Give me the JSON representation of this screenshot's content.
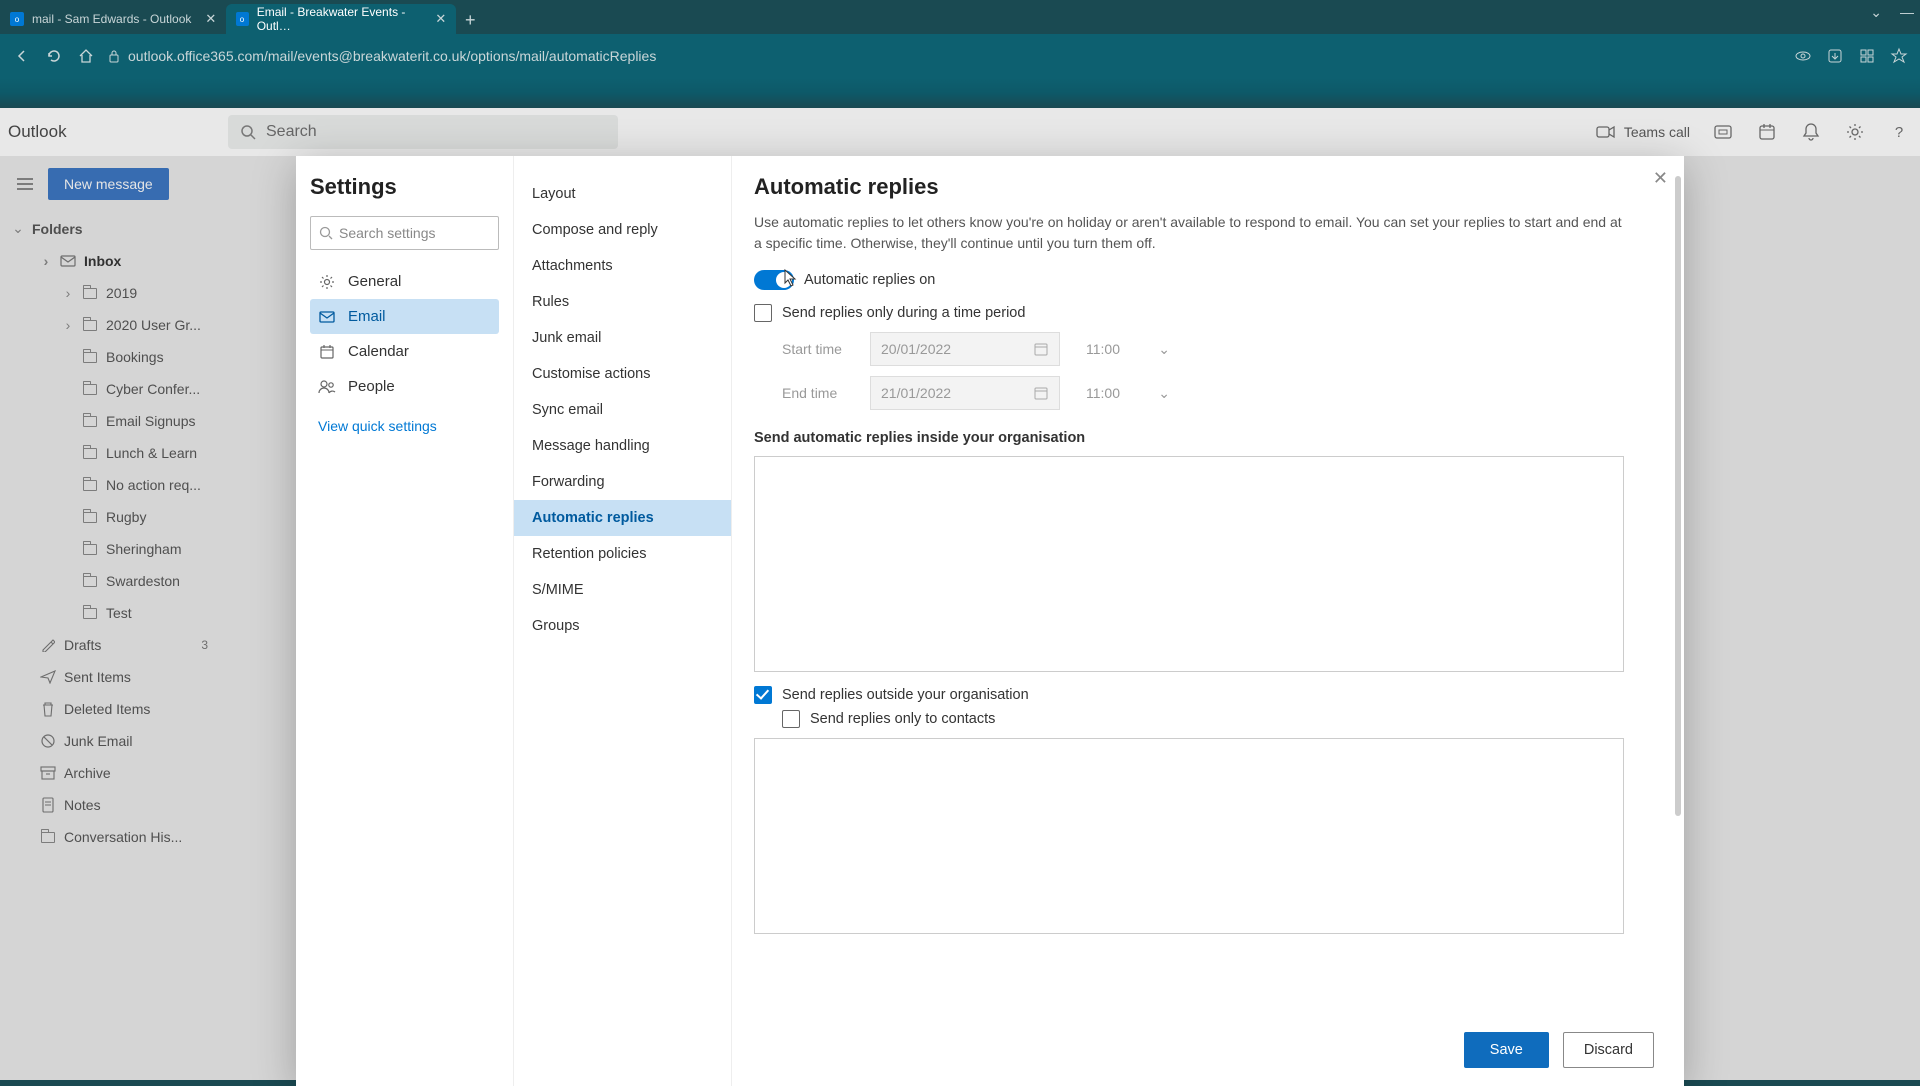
{
  "browser": {
    "tabs": [
      {
        "title": "mail - Sam Edwards - Outlook",
        "active": false
      },
      {
        "title": "Email - Breakwater Events - Outl…",
        "active": true
      }
    ],
    "url": "outlook.office365.com/mail/events@breakwaterit.co.uk/options/mail/automaticReplies"
  },
  "owa": {
    "brand": "Outlook",
    "search_placeholder": "Search",
    "teams_call": "Teams call",
    "new_message": "New message",
    "folders_label": "Folders",
    "folders": [
      {
        "label": "Inbox",
        "bold": true,
        "level": "sub",
        "caret": true,
        "icon": "mail"
      },
      {
        "label": "2019",
        "level": "subsub",
        "caret": true,
        "icon": "folder"
      },
      {
        "label": "2020 User Gr...",
        "level": "subsub",
        "caret": true,
        "icon": "folder"
      },
      {
        "label": "Bookings",
        "level": "subsub",
        "icon": "folder"
      },
      {
        "label": "Cyber Confer...",
        "level": "subsub",
        "icon": "folder"
      },
      {
        "label": "Email Signups",
        "level": "subsub",
        "icon": "folder"
      },
      {
        "label": "Lunch & Learn",
        "level": "subsub",
        "icon": "folder"
      },
      {
        "label": "No action req...",
        "level": "subsub",
        "icon": "folder"
      },
      {
        "label": "Rugby",
        "level": "subsub",
        "icon": "folder"
      },
      {
        "label": "Sheringham",
        "level": "subsub",
        "icon": "folder"
      },
      {
        "label": "Swardeston",
        "level": "subsub",
        "icon": "folder"
      },
      {
        "label": "Test",
        "level": "subsub",
        "icon": "folder"
      },
      {
        "label": "Drafts",
        "level": "sub",
        "icon": "draft",
        "count": "3"
      },
      {
        "label": "Sent Items",
        "level": "sub",
        "icon": "sent"
      },
      {
        "label": "Deleted Items",
        "level": "sub",
        "icon": "trash"
      },
      {
        "label": "Junk Email",
        "level": "sub",
        "icon": "junk"
      },
      {
        "label": "Archive",
        "level": "sub",
        "icon": "archive"
      },
      {
        "label": "Notes",
        "level": "sub",
        "icon": "note"
      },
      {
        "label": "Conversation His...",
        "level": "sub",
        "icon": "folder"
      }
    ]
  },
  "settings": {
    "title": "Settings",
    "search_placeholder": "Search settings",
    "quick_settings": "View quick settings",
    "categories": [
      {
        "label": "General",
        "icon": "gear"
      },
      {
        "label": "Email",
        "icon": "mail",
        "active": true
      },
      {
        "label": "Calendar",
        "icon": "calendar"
      },
      {
        "label": "People",
        "icon": "people"
      }
    ],
    "subitems": [
      "Layout",
      "Compose and reply",
      "Attachments",
      "Rules",
      "Junk email",
      "Customise actions",
      "Sync email",
      "Message handling",
      "Forwarding",
      "Automatic replies",
      "Retention policies",
      "S/MIME",
      "Groups"
    ],
    "sub_active": "Automatic replies"
  },
  "auto": {
    "title": "Automatic replies",
    "desc": "Use automatic replies to let others know you're on holiday or aren't available to respond to email. You can set your replies to start and end at a specific time. Otherwise, they'll continue until you turn them off.",
    "toggle_label": "Automatic replies on",
    "time_period_label": "Send replies only during a time period",
    "start_label": "Start time",
    "end_label": "End time",
    "start_date": "20/01/2022",
    "start_time": "11:00",
    "end_date": "21/01/2022",
    "end_time": "11:00",
    "inside_label": "Send automatic replies inside your organisation",
    "outside_label": "Send replies outside your organisation",
    "contacts_only_label": "Send replies only to contacts",
    "save": "Save",
    "discard": "Discard"
  }
}
